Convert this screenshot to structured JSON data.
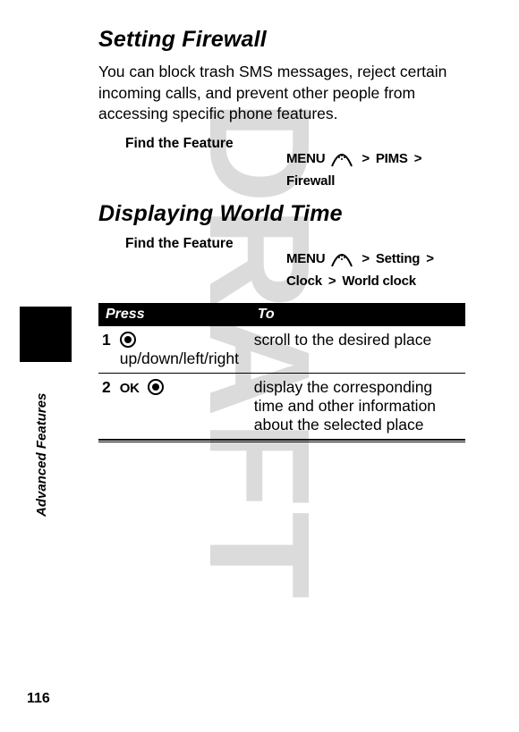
{
  "watermark": "DRAFT",
  "section1": {
    "title": "Setting Firewall",
    "body": "You can block trash SMS messages, reject certain incoming calls, and prevent other people from accessing specific phone features.",
    "find_label": "Find the Feature",
    "menu_parts": {
      "menu": "MENU",
      "p1": "PIMS",
      "p2": "Firewall"
    }
  },
  "section2": {
    "title": "Displaying World Time",
    "find_label": "Find the Feature",
    "menu_parts": {
      "menu": "MENU",
      "p1": "Setting",
      "p2": "Clock",
      "p3": "World clock"
    }
  },
  "table": {
    "head_press": "Press",
    "head_to": "To",
    "row1": {
      "num": "1",
      "press_desc": " up/down/left/right",
      "to": "scroll to the desired place"
    },
    "row2": {
      "num": "2",
      "press_ok": "OK",
      "to": "display the corresponding time and other information about the selected place"
    }
  },
  "side_label": "Advanced Features",
  "page_number": "116",
  "gt_symbol": ">"
}
